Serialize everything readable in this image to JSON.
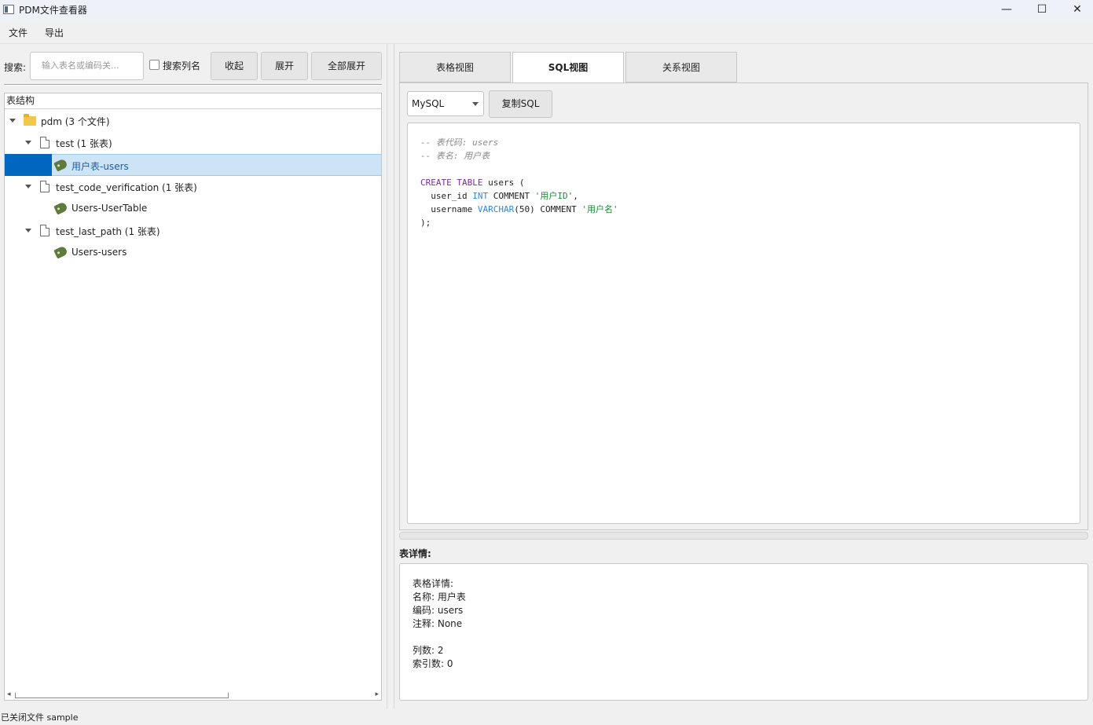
{
  "window": {
    "title": "PDM文件查看器",
    "minimize_glyph": "—",
    "maximize_glyph": "☐",
    "close_glyph": "✕"
  },
  "menu": {
    "file": "文件",
    "export": "导出"
  },
  "search": {
    "label": "搜索:",
    "placeholder": "输入表名或编码关...",
    "checkbox_label": "搜索列名",
    "checkbox_checked": false
  },
  "toolbar": {
    "collapse": "收起",
    "expand": "展开",
    "expand_all": "全部展开"
  },
  "tree": {
    "header": "表结构",
    "root": {
      "label": "pdm (3 个文件)",
      "icon": "folder-icon"
    },
    "files": [
      {
        "label": "test (1 张表)",
        "icon": "file-icon",
        "tables": [
          {
            "label": "用户表-users",
            "selected": true,
            "icon": "table-tag-icon"
          }
        ]
      },
      {
        "label": "test_code_verification (1 张表)",
        "icon": "file-icon",
        "tables": [
          {
            "label": "Users-UserTable",
            "selected": false,
            "icon": "table-tag-icon"
          }
        ]
      },
      {
        "label": "test_last_path (1 张表)",
        "icon": "file-icon",
        "tables": [
          {
            "label": "Users-users",
            "selected": false,
            "icon": "table-tag-icon"
          }
        ]
      }
    ]
  },
  "tabs": [
    {
      "label": "表格视图",
      "active": false
    },
    {
      "label": "SQL视图",
      "active": true
    },
    {
      "label": "关系视图",
      "active": false
    }
  ],
  "sql_view": {
    "dialect": "MySQL",
    "copy_button": "复制SQL",
    "code": {
      "line1": "-- 表代码: users",
      "line2": "-- 表名: 用户表",
      "create_kw": "CREATE TABLE",
      "table_name": " users (",
      "col1_name": "  user_id ",
      "col1_type": "INT",
      "col1_comment_kw": " COMMENT ",
      "col1_comment": "'用户ID'",
      "col1_end": ",",
      "col2_name": "  username ",
      "col2_type": "VARCHAR",
      "col2_len": "(50)",
      "col2_comment_kw": " COMMENT ",
      "col2_comment": "'用户名'",
      "close": ");"
    }
  },
  "details": {
    "title": "表详情:",
    "lines": [
      "表格详情:",
      "名称: 用户表",
      "编码: users",
      "注释: None",
      "",
      "列数: 2",
      "索引数: 0"
    ]
  },
  "status": "已关闭文件 sample",
  "colors": {
    "selection": "#0067c0",
    "selection_row": "#cde4f7",
    "sql_keyword": "#7a2b9a",
    "sql_type": "#2e8ad6",
    "sql_string": "#1f8a3c",
    "sql_comment": "#8a8a8a"
  }
}
